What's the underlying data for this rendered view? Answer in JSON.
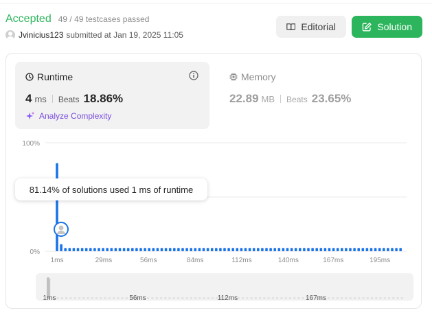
{
  "status": {
    "label": "Accepted",
    "testcases": "49 / 49 testcases passed"
  },
  "submission": {
    "user": "Jvinicius123",
    "submitted_at": "submitted at Jan 19, 2025 11:05"
  },
  "toolbar": {
    "editorial_label": "Editorial",
    "solution_label": "Solution"
  },
  "runtime": {
    "title": "Runtime",
    "value": "4",
    "unit": "ms",
    "beats_label": "Beats",
    "beats_value": "18.86%",
    "analyze_label": "Analyze Complexity"
  },
  "memory": {
    "title": "Memory",
    "value": "22.89",
    "unit": "MB",
    "beats_label": "Beats",
    "beats_value": "23.65%"
  },
  "tooltip": {
    "text": "81.14% of solutions used 1 ms of runtime"
  },
  "colors": {
    "accent": "#2db55d",
    "bar": "#1a73e8",
    "analyze": "#7a4ddb"
  },
  "chart_data": {
    "type": "bar",
    "y_tick_labels": [
      "100%",
      "0%"
    ],
    "ylim": [
      0,
      100
    ],
    "x_tick_labels": [
      "1ms",
      "29ms",
      "56ms",
      "84ms",
      "112ms",
      "140ms",
      "167ms",
      "195ms"
    ],
    "x": [
      1,
      2,
      3,
      4,
      5,
      6,
      7,
      8,
      9,
      10,
      11,
      12,
      13,
      14,
      15,
      16,
      17,
      18,
      19,
      20,
      21,
      22,
      23,
      24,
      25,
      26,
      27,
      28,
      29,
      30,
      31,
      32,
      33,
      34,
      35,
      36,
      37,
      38,
      39,
      40,
      41,
      42,
      43,
      44,
      45,
      46,
      47,
      48,
      49,
      50,
      51,
      52,
      53,
      54,
      55,
      56,
      57,
      58,
      59,
      60,
      61,
      62,
      63,
      64,
      65,
      66,
      67,
      68,
      69,
      70,
      71,
      72,
      73,
      74,
      75,
      76,
      77,
      78,
      79,
      80,
      81,
      82,
      83
    ],
    "values": [
      81.14,
      6.5,
      3,
      3,
      3,
      3,
      3,
      3,
      3,
      3,
      3,
      3,
      3,
      3,
      3,
      3,
      3,
      3,
      3,
      3,
      3,
      3,
      3,
      3,
      3,
      3,
      3,
      3,
      3,
      3,
      3,
      3,
      3,
      3,
      3,
      3,
      3,
      3,
      3,
      3,
      3,
      3,
      3,
      3,
      3,
      3,
      3,
      3,
      3,
      3,
      3,
      3,
      3,
      3,
      3,
      3,
      3,
      3,
      3,
      3,
      3,
      3,
      3,
      3,
      3,
      3,
      3,
      3,
      3,
      3,
      3,
      3,
      3,
      3,
      3,
      3,
      3,
      3,
      3,
      3,
      3,
      3,
      3
    ],
    "highlight_x": 4,
    "range_tick_labels": [
      "1ms",
      "56ms",
      "112ms",
      "167ms"
    ],
    "grid": true
  }
}
